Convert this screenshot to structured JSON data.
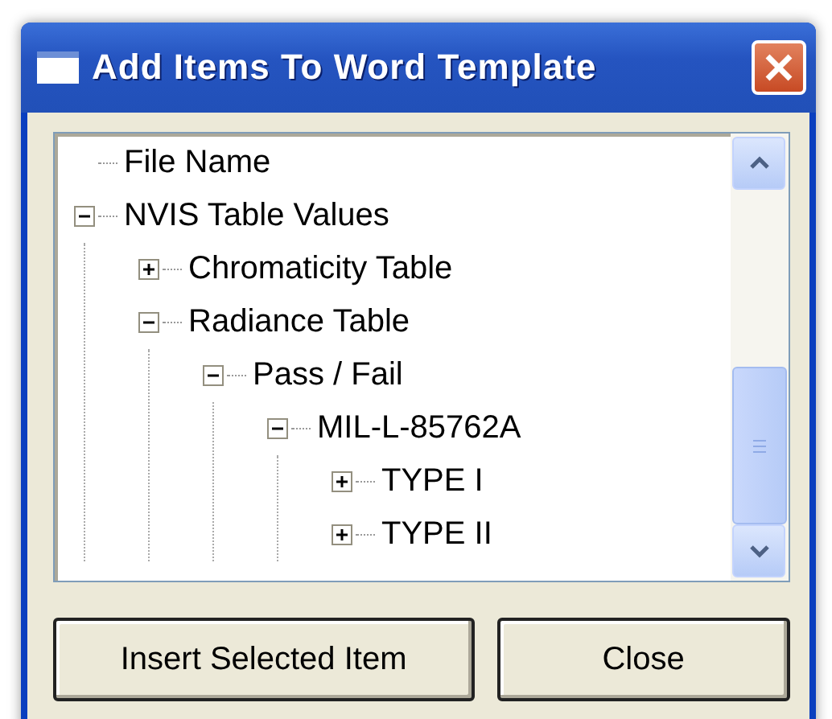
{
  "window": {
    "title": "Add Items To Word Template"
  },
  "tree": [
    {
      "label": "File Name"
    },
    {
      "label": "NVIS Table Values",
      "expanded": true,
      "children": [
        {
          "label": "Chromaticity Table",
          "expanded": false
        },
        {
          "label": "Radiance Table",
          "expanded": true,
          "children": [
            {
              "label": "Pass / Fail",
              "expanded": true,
              "children": [
                {
                  "label": "MIL-L-85762A",
                  "expanded": true,
                  "children": [
                    {
                      "label": "TYPE I",
                      "expanded": false
                    },
                    {
                      "label": "TYPE II",
                      "expanded": false
                    }
                  ]
                }
              ]
            }
          ]
        }
      ]
    }
  ],
  "buttons": [
    "Insert Selected Item",
    "Close"
  ]
}
